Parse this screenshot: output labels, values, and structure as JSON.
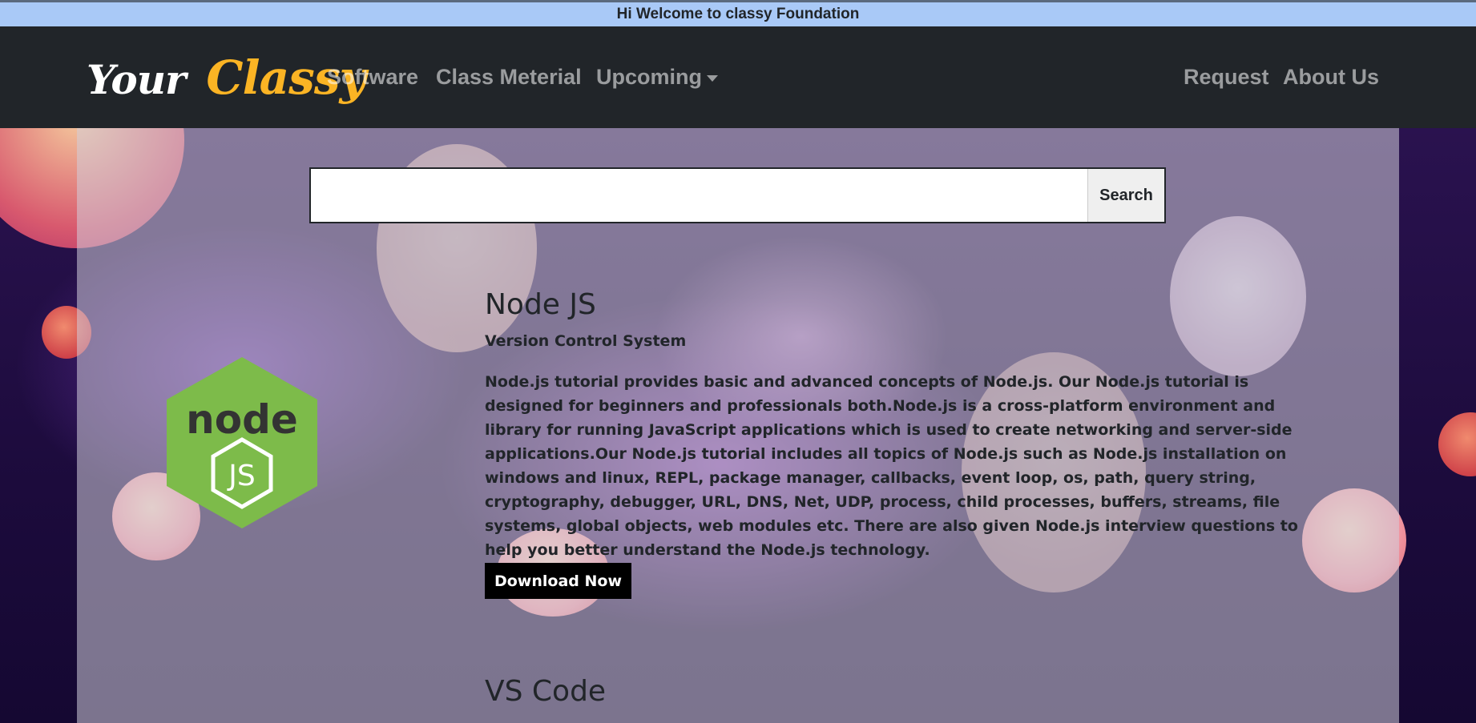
{
  "welcome": {
    "text": "Hi Welcome to classy Foundation"
  },
  "navbar": {
    "brand_your": "Your",
    "brand_classy": "Classy",
    "links": {
      "software": "Software",
      "class_material": "Class Meterial",
      "upcoming": "Upcoming",
      "request": "Request",
      "about": "About Us"
    }
  },
  "search": {
    "button": "Search",
    "value": "",
    "placeholder": ""
  },
  "main": {
    "item1": {
      "title": "Node JS",
      "subtitle": "Version Control System",
      "description": "Node.js tutorial provides basic and advanced concepts of Node.js. Our Node.js tutorial is designed for beginners and professionals both.Node.js is a cross-platform environment and library for running JavaScript applications which is used to create networking and server-side applications.Our Node.js tutorial includes all topics of Node.js such as Node.js installation on windows and linux, REPL, package manager, callbacks, event loop, os, path, query string, cryptography, debugger, URL, DNS, Net, UDP, process, child processes, buffers, streams, file systems, global objects, web modules etc. There are also given Node.js interview questions to help you better understand the Node.js technology.",
      "button": "Download Now",
      "logo_word": "node",
      "logo_badge": "JS"
    },
    "item2": {
      "title": "VS Code"
    }
  },
  "colors": {
    "welcome_bg": "#a9c9f7",
    "navbar_bg": "#212529",
    "brand_accent": "#fbb424",
    "node_green": "#7dbb4a",
    "button_bg": "#000000"
  },
  "icons": {
    "logo": "nodejs-logo-icon",
    "dropdown": "caret-down-icon"
  }
}
